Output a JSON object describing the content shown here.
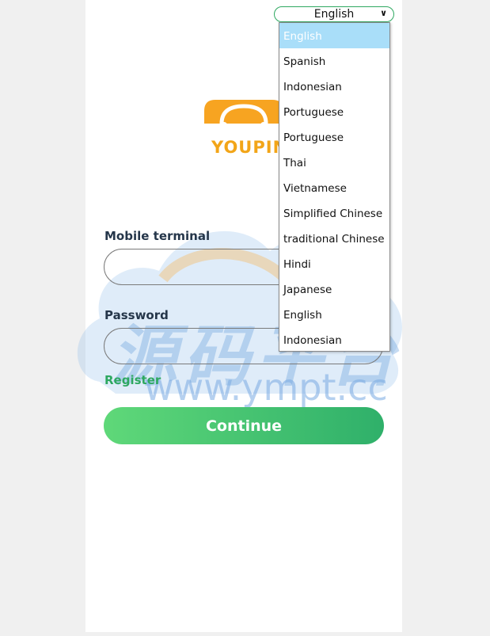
{
  "language": {
    "selected": "English",
    "options": [
      "English",
      "Spanish",
      "Indonesian",
      "Portuguese",
      "Portuguese",
      "Thai",
      "Vietnamese",
      "Simplified Chinese",
      "traditional Chinese",
      "Hindi",
      "Japanese",
      "English",
      "Indonesian"
    ]
  },
  "logo": {
    "text": "YOUPIN"
  },
  "form": {
    "mobile_label": "Mobile terminal",
    "password_label": "Password",
    "register_link": "Register",
    "continue_button": "Continue"
  },
  "watermark": {
    "chinese": "源码平台",
    "url": "www.ympt.cc"
  },
  "colors": {
    "accent": "#2ea860",
    "logo": "#f2a518",
    "selected_option": "#a9def9"
  }
}
